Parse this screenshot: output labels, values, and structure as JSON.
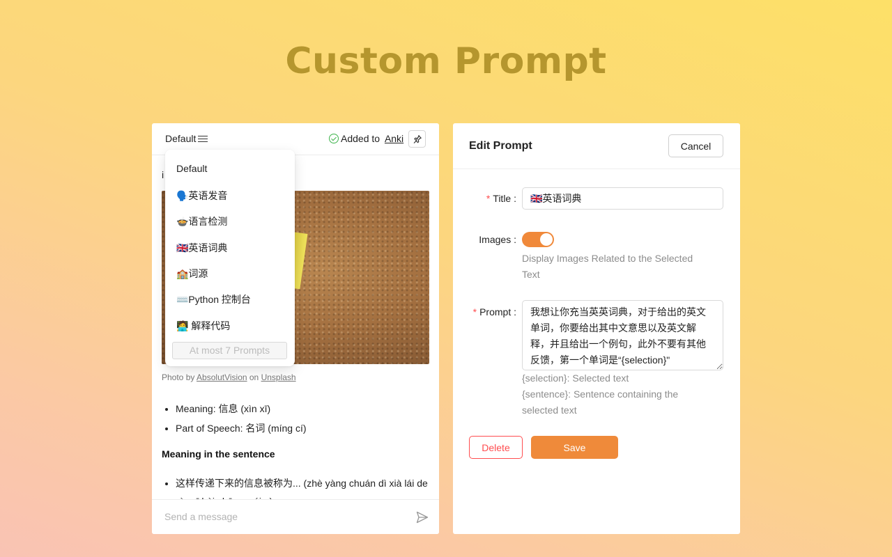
{
  "hero": {
    "title": "Custom Prompt"
  },
  "chat_panel": {
    "prompt_selector": "Default",
    "added_prefix": "Added to ",
    "added_link": "Anki",
    "peek_text": "i",
    "photo_credit": {
      "prefix": "Photo by ",
      "author": "AbsolutVision",
      "middle": " on ",
      "site": "Unsplash"
    },
    "meaning_items": [
      "Meaning: 信息 (xìn xī)",
      "Part of Speech: 名词 (míng cí)"
    ],
    "section_heading": "Meaning in the sentence",
    "sentence_item": "这样传递下来的信息被称为... (zhè yàng chuán dì xià lái de xìn xī bèi chēng wéi...)",
    "message_placeholder": "Send a message"
  },
  "dropdown": {
    "items": [
      "Default",
      "🗣️英语发音",
      "🍲语言检测",
      "🇬🇧英语词典",
      "🏫词源",
      "⌨️Python 控制台",
      "🧑‍💻 解释代码"
    ],
    "limit_label": "At most 7 Prompts"
  },
  "edit_panel": {
    "title": "Edit Prompt",
    "cancel_label": "Cancel",
    "title_label": "Title",
    "title_value": "🇬🇧英语词典",
    "images_label": "Images",
    "images_enabled": true,
    "images_help_line1": "Display Images Related to the Selected",
    "images_help_line2": "Text",
    "prompt_label": "Prompt",
    "prompt_value": "我想让你充当英英词典，对于给出的英文单词，你要给出其中文意思以及英文解释，并且给出一个例句，此外不要有其他反馈，第一个单词是“{selection}\"",
    "hint_selection": "{selection}: Selected text",
    "hint_sentence_line1": "{sentence}: Sentence containing the",
    "hint_sentence_line2": "selected text",
    "delete_label": "Delete",
    "save_label": "Save"
  },
  "colors": {
    "accent": "#ef8a3a",
    "danger": "#ff4d4f",
    "title_gold": "#b5962e",
    "success": "#3cb34a"
  }
}
